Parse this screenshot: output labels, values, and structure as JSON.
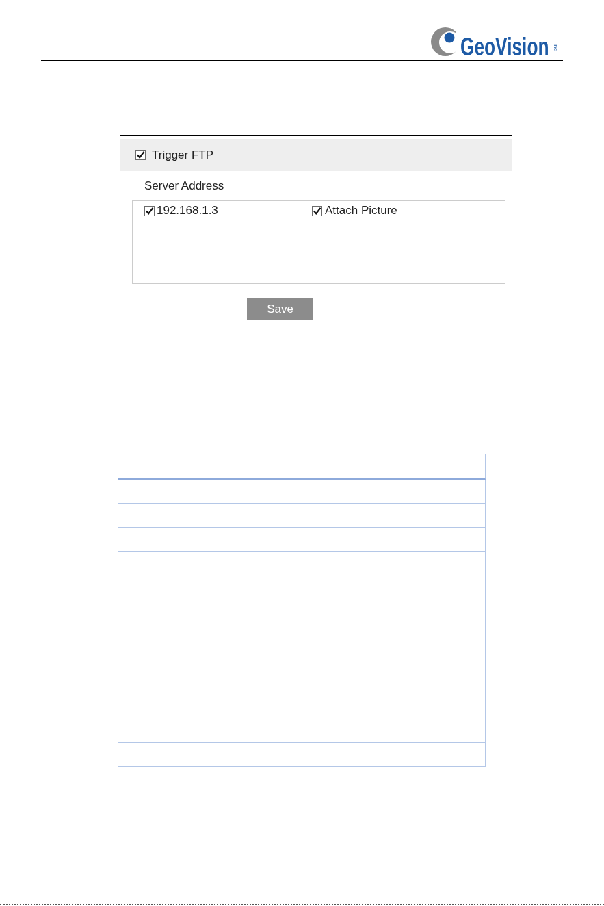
{
  "header": {
    "logo": {
      "wordmark": "GeoVision",
      "suffix": "inc"
    }
  },
  "settings_panel": {
    "trigger": {
      "label": "Trigger FTP",
      "checked": true
    },
    "server_address_label": "Server Address",
    "servers": [
      {
        "address": "192.168.1.3",
        "checked": true,
        "attach_picture": {
          "label": "Attach Picture",
          "checked": true
        }
      }
    ],
    "save_button": "Save"
  },
  "table": {
    "rows": [
      {
        "kind": "header"
      },
      {
        "kind": "body"
      },
      {
        "kind": "body"
      },
      {
        "kind": "body"
      },
      {
        "kind": "body"
      },
      {
        "kind": "body"
      },
      {
        "kind": "body"
      },
      {
        "kind": "body"
      },
      {
        "kind": "body"
      },
      {
        "kind": "body"
      },
      {
        "kind": "body"
      },
      {
        "kind": "body"
      },
      {
        "kind": "body"
      }
    ]
  }
}
